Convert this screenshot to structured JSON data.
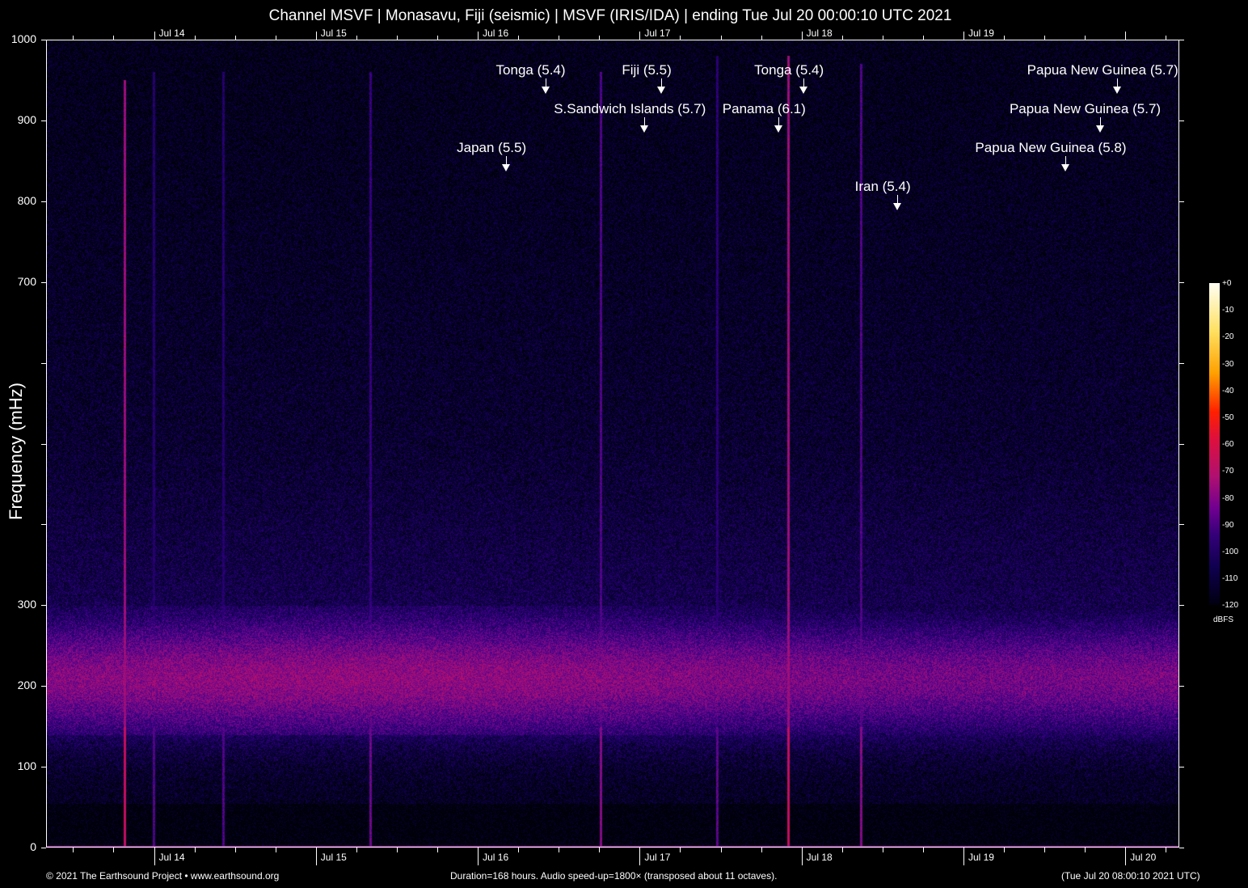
{
  "chart_data": {
    "type": "heatmap",
    "title": "Channel MSVF | Monasavu, Fiji (seismic) | MSVF (IRIS/IDA) | ending Tue Jul 20 00:00:10 UTC 2021",
    "ylabel": "Frequency (mHz)",
    "xlabel": "",
    "ylim": [
      0,
      1000
    ],
    "xlim_hours": [
      0,
      168
    ],
    "y_ticks": [
      0,
      100,
      200,
      300,
      400,
      500,
      600,
      700,
      800,
      900,
      1000
    ],
    "y_tick_labels": [
      "0",
      "100",
      "200",
      "300",
      "",
      "",
      "",
      "700",
      "800",
      "900",
      "1000"
    ],
    "x_ticks": [
      {
        "label": "Jul 14",
        "hour": 16
      },
      {
        "label": "Jul 15",
        "hour": 40
      },
      {
        "label": "Jul 16",
        "hour": 64
      },
      {
        "label": "Jul 17",
        "hour": 88
      },
      {
        "label": "Jul 18",
        "hour": 112
      },
      {
        "label": "Jul 19",
        "hour": 136
      },
      {
        "label": "Jul 20",
        "hour": 160
      }
    ],
    "colorbar": {
      "label": "dBFS",
      "range": [
        -120,
        0
      ],
      "ticks": [
        "+0",
        "-10",
        "-20",
        "-30",
        "-40",
        "-50",
        "-60",
        "-70",
        "-80",
        "-90",
        "-100",
        "-110",
        "-120"
      ]
    },
    "background_band": {
      "center_mhz": 210,
      "low_mhz": 140,
      "high_mhz": 290,
      "level_dbfs": -80
    },
    "annotations": [
      {
        "label": "Tonga (5.4)",
        "hour": 74
      },
      {
        "label": "Fiji (5.5)",
        "hour": 91.2
      },
      {
        "label": "Tonga (5.4)",
        "hour": 112.3
      },
      {
        "label": "Papua New Guinea (5.7)",
        "hour": 158.8
      },
      {
        "label": "S.Sandwich Islands (5.7)",
        "hour": 88.7
      },
      {
        "label": "Panama (6.1)",
        "hour": 108.6
      },
      {
        "label": "Papua New Guinea (5.7)",
        "hour": 156.2
      },
      {
        "label": "Japan (5.5)",
        "hour": 68.2
      },
      {
        "label": "Papua New Guinea (5.8)",
        "hour": 151.1
      },
      {
        "label": "Iran (5.4)",
        "hour": 126.2
      }
    ],
    "event_lines": [
      {
        "hour": 11.6,
        "top_mhz": 950,
        "level": -65
      },
      {
        "hour": 15.9,
        "top_mhz": 960,
        "level": -90
      },
      {
        "hour": 26.2,
        "top_mhz": 960,
        "level": -90
      },
      {
        "hour": 48,
        "top_mhz": 960,
        "level": -85
      },
      {
        "hour": 82.2,
        "top_mhz": 960,
        "level": -80
      },
      {
        "hour": 99.4,
        "top_mhz": 980,
        "level": -88
      },
      {
        "hour": 110,
        "top_mhz": 980,
        "level": -65
      },
      {
        "hour": 120.8,
        "top_mhz": 970,
        "level": -80
      }
    ]
  },
  "footer": {
    "copyright": "© 2021 The Earthsound Project • www.earthsound.org",
    "info": "Duration=168 hours. Audio speed-up=1800× (transposed about 11 octaves).",
    "end_time": "(Tue Jul 20 08:00:10 2021 UTC)"
  }
}
